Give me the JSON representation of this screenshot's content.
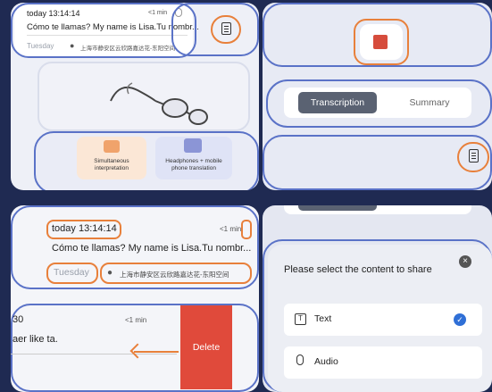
{
  "tl": {
    "date": "today 13:14:14",
    "duration": "<1 min",
    "text": "Cómo te llamas? My name is Lisa.Tu nombr...",
    "day": "Tuesday",
    "location": "上海市静安区云欣路嘉达花-东阳空间",
    "feature1": "Simultaneous interpretation",
    "feature2": "Headphones + mobile phone translation"
  },
  "tr": {
    "tabs": [
      "Transcription",
      "Summary"
    ]
  },
  "bl": {
    "date": "today 13:14:14",
    "duration": "<1 min",
    "text": "Cómo te llamas? My name is Lisa.Tu nombr...",
    "day": "Tuesday",
    "location": "上海市静安区云欣路嘉达花-东阳空间",
    "swiped_time": "30",
    "swiped_duration": "<1 min",
    "swiped_text": "aer like ta.",
    "delete_label": "Delete"
  },
  "br": {
    "prompt": "Please select the content to share",
    "options": [
      "Text",
      "Audio"
    ]
  },
  "colors": {
    "ring_blue": "#5a72c7",
    "highlight_orange": "#e8803b",
    "delete_red": "#e04a3b",
    "stop_red": "#d64c3c",
    "check_blue": "#2f6fd6"
  }
}
